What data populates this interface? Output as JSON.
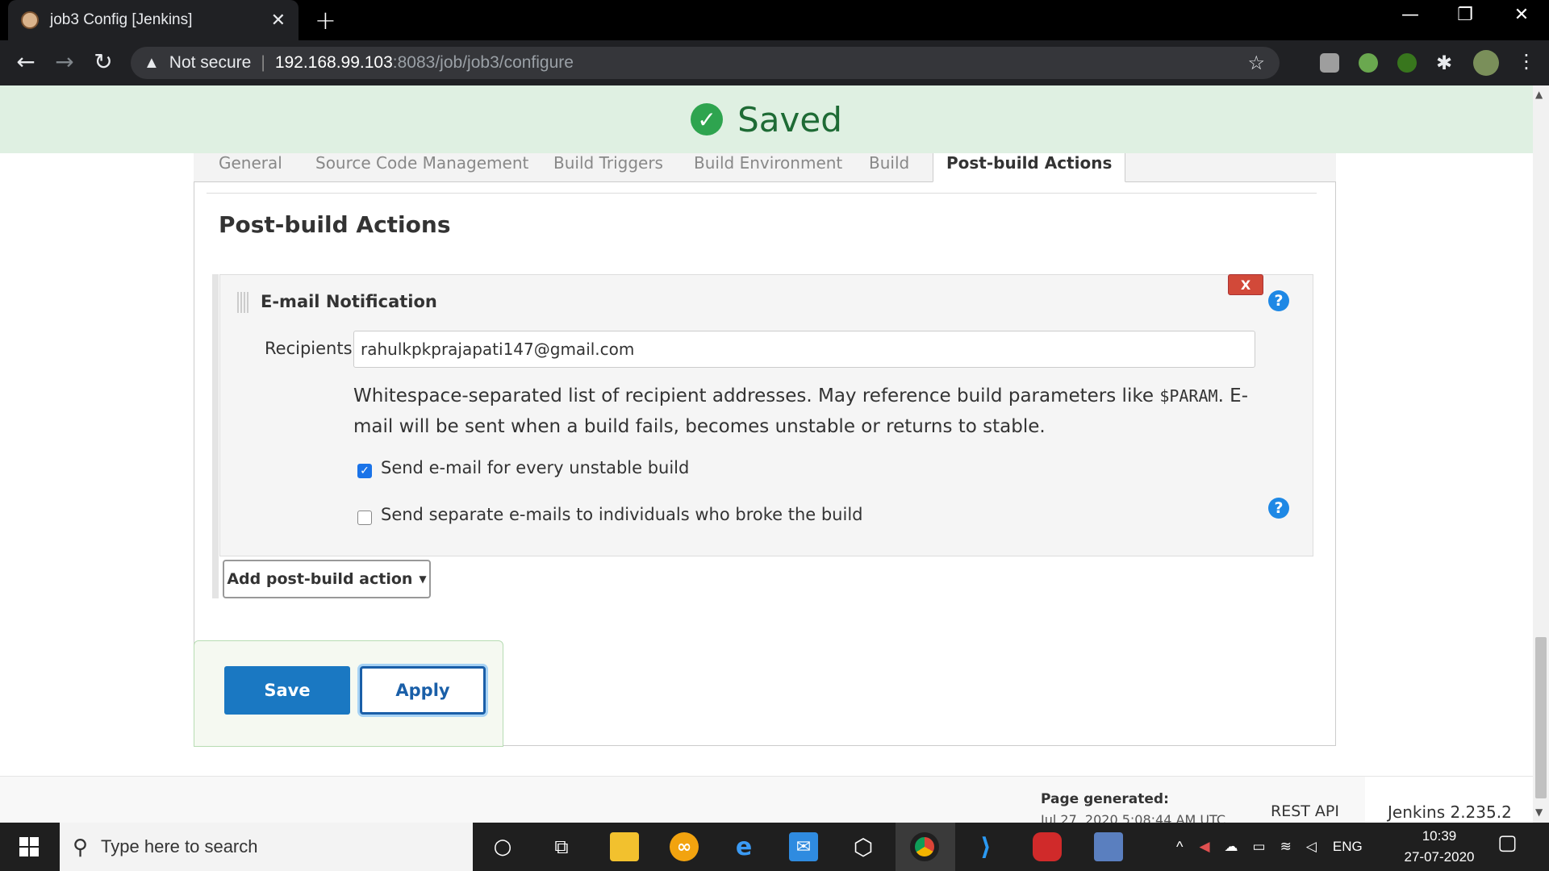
{
  "browser": {
    "tab_title": "job3 Config [Jenkins]",
    "tab_close": "✕",
    "new_tab": "+",
    "security_label": "Not secure",
    "url_host": "192.168.99.103",
    "url_path": ":8083/job/job3/configure"
  },
  "banner": {
    "text": "Saved",
    "check": "✓"
  },
  "config_tabs": [
    "General",
    "Source Code Management",
    "Build Triggers",
    "Build Environment",
    "Build",
    "Post-build Actions"
  ],
  "active_tab": "Post-build Actions",
  "section_title": "Post-build Actions",
  "email_notification": {
    "title": "E-mail Notification",
    "delete_label": "X",
    "help_label": "?",
    "recipients_label": "Recipients",
    "recipients_value": "rahulkpkprajapati147@gmail.com",
    "help_text_1": "Whitespace-separated list of recipient addresses. May reference build parameters like ",
    "help_text_code": "$PARAM",
    "help_text_2": ". E-mail will be sent when a build fails, becomes unstable or returns to stable.",
    "checkbox_unstable_label": "Send e-mail for every unstable build",
    "checkbox_unstable_checked": true,
    "checkbox_separate_label": "Send separate e-mails to individuals who broke the build",
    "checkbox_separate_checked": false
  },
  "add_action_label": "Add post-build action",
  "buttons": {
    "save": "Save",
    "apply": "Apply"
  },
  "footer": {
    "page_generated_label": "Page generated:",
    "page_generated_value": "Jul 27, 2020 5:08:44 AM UTC",
    "rest_api": "REST API",
    "version": "Jenkins 2.235.2"
  },
  "taskbar": {
    "search_placeholder": "Type here to search",
    "language": "ENG",
    "time": "10:39",
    "date": "27-07-2020"
  },
  "colors": {
    "saved_banner": "#dff0e2",
    "save_button": "#1a78c2",
    "delete_button": "#d24939",
    "help_icon": "#1e88e5"
  }
}
